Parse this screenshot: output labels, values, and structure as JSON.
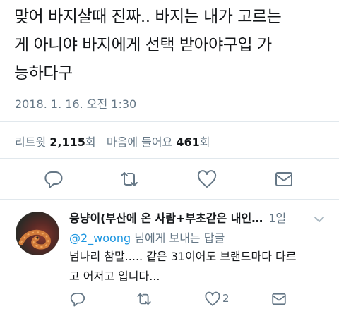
{
  "tweet": {
    "text_line1": "맞어 바지살때 진짜.. 바지는 내가 고르는",
    "text_line2": "게 아니야 바지에게 선택 받아야구입 가",
    "text_line3": "능하다구",
    "timestamp": "2018. 1. 16. 오전 1:30",
    "retweets_label": "리트윗",
    "retweets_count": "2,115",
    "retweets_unit": "회",
    "likes_label": "마음에 들어요",
    "likes_count": "461",
    "likes_unit": "회"
  },
  "actions": {
    "icons": [
      "reply-icon",
      "retweet-icon",
      "like-icon",
      "message-icon"
    ],
    "color": "#657786"
  },
  "reply": {
    "name": "웅냥이(부산에 온 사람+부초같은 내인…",
    "time": "1일",
    "replying_handle": "@2_woong",
    "replying_suffix": "님에게 보내는 답글",
    "text_line1": "넘나리 참말..... 같은 31이어도 브랜드마다 다르",
    "text_line2": "고 어저고 입니다...",
    "like_count": "2"
  },
  "colors": {
    "link": "#1b95e0",
    "muted": "#657786",
    "text": "#14171a",
    "divider": "#e1e8ed"
  }
}
